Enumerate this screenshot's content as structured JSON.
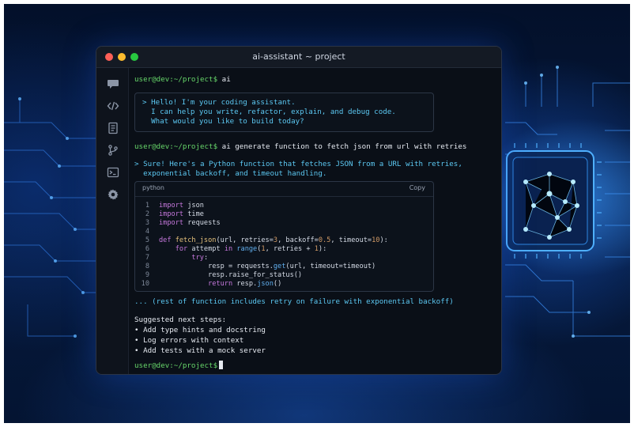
{
  "window": {
    "title": "ai-assistant ~ project"
  },
  "sidebar": {
    "icons": [
      "chat-icon",
      "code-icon",
      "file-icon",
      "git-branch-icon",
      "terminal-icon",
      "gear-icon"
    ]
  },
  "terminal": {
    "prompt": "user@dev:~/project$",
    "cmd1": "ai",
    "greeting": [
      "> Hello! I'm your coding assistant.",
      "  I can help you write, refactor, explain, and debug code.",
      "  What would you like to build today?"
    ],
    "cmd2": "ai generate function to fetch json from url with retries",
    "response": [
      "> Sure! Here's a Python function that fetches JSON from a URL with retries,",
      "  exponential backoff, and timeout handling."
    ],
    "code": {
      "language": "python",
      "copy_label": "Copy",
      "lines": [
        {
          "n": "1",
          "parts": [
            [
              "kw",
              "import"
            ],
            [
              "",
              " json"
            ]
          ]
        },
        {
          "n": "2",
          "parts": [
            [
              "kw",
              "import"
            ],
            [
              "",
              " time"
            ]
          ]
        },
        {
          "n": "3",
          "parts": [
            [
              "kw",
              "import"
            ],
            [
              "",
              " requests"
            ]
          ]
        },
        {
          "n": "4",
          "parts": []
        },
        {
          "n": "5",
          "parts": [
            [
              "kw",
              "def "
            ],
            [
              "fn",
              "fetch_json"
            ],
            [
              "",
              "(url, retries="
            ],
            [
              "num",
              "3"
            ],
            [
              "",
              ", backoff="
            ],
            [
              "num",
              "0.5"
            ],
            [
              "",
              ", timeout="
            ],
            [
              "num",
              "10"
            ],
            [
              "",
              "):"
            ]
          ]
        },
        {
          "n": "6",
          "parts": [
            [
              "",
              "    "
            ],
            [
              "kw",
              "for"
            ],
            [
              "",
              " attempt "
            ],
            [
              "kw",
              "in"
            ],
            [
              "",
              " "
            ],
            [
              "mth",
              "range"
            ],
            [
              "",
              "("
            ],
            [
              "num",
              "1"
            ],
            [
              "",
              ", retries + "
            ],
            [
              "num",
              "1"
            ],
            [
              "",
              "):"
            ]
          ]
        },
        {
          "n": "7",
          "parts": [
            [
              "",
              "        "
            ],
            [
              "kw",
              "try"
            ],
            [
              "",
              ":"
            ]
          ]
        },
        {
          "n": "8",
          "parts": [
            [
              "",
              "            resp = requests."
            ],
            [
              "mth",
              "get"
            ],
            [
              "",
              "(url, timeout=timeout)"
            ]
          ]
        },
        {
          "n": "9",
          "parts": [
            [
              "",
              "            resp.raise_for_status()"
            ]
          ]
        },
        {
          "n": "10",
          "parts": [
            [
              "",
              "            "
            ],
            [
              "kw",
              "return"
            ],
            [
              "",
              " resp."
            ],
            [
              "mth",
              "json"
            ],
            [
              "",
              "()"
            ]
          ]
        }
      ]
    },
    "rest_note": "... (rest of function includes retry on failure with exponential backoff)",
    "suggest_title": "Suggested next steps:",
    "suggestions": [
      "• Add type hints and docstring",
      "• Log errors with context",
      "• Add tests with a mock server"
    ]
  },
  "colors": {
    "prompt": "#67d76a",
    "response": "#5cc8f2",
    "keyword": "#c678dd",
    "function": "#e5c07b",
    "number": "#d19a66"
  }
}
